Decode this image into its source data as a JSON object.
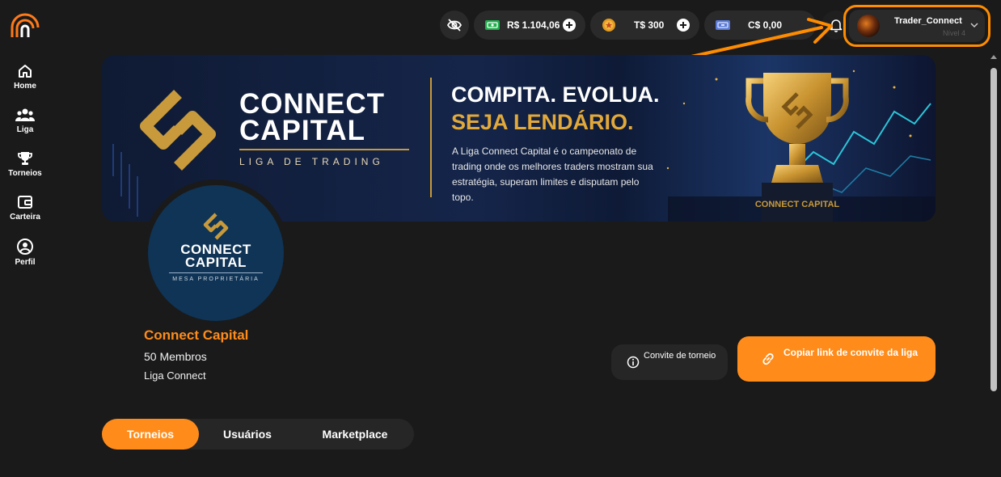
{
  "sidebar": {
    "logo_icon": "app-logo-arc-icon",
    "items": [
      {
        "label": "Home",
        "icon": "home-icon"
      },
      {
        "label": "Liga",
        "icon": "users-icon"
      },
      {
        "label": "Torneios",
        "icon": "trophy-icon"
      },
      {
        "label": "Carteira",
        "icon": "wallet-icon"
      },
      {
        "label": "Perfil",
        "icon": "user-circle-icon"
      }
    ]
  },
  "topbar": {
    "hide_balance_icon": "eye-off-icon",
    "wallets": [
      {
        "amount": "R$ 1.104,06",
        "icon": "cash-icon",
        "has_add": true
      },
      {
        "amount": "T$ 300",
        "icon": "coin-icon",
        "has_add": true
      },
      {
        "amount": "C$ 0,00",
        "icon": "money-card-icon",
        "has_add": false
      }
    ],
    "notifications_icon": "bell-icon",
    "user": {
      "name": "Trader_Connect",
      "level": "Nível 4"
    }
  },
  "banner": {
    "brand_title_line1": "CONNECT",
    "brand_title_line2": "CAPITAL",
    "brand_subtitle": "LIGA DE TRADING",
    "headline1": "COMPITA. EVOLUA.",
    "headline2": "SEJA LENDÁRIO.",
    "description": "A Liga Connect Capital é o campeonato de trading onde os melhores traders mostram sua estratégia, superam limites e disputam pelo topo.",
    "trophy_text": "CONNECT CAPITAL"
  },
  "league": {
    "avatar_title_line1": "CONNECT",
    "avatar_title_line2": "CAPITAL",
    "avatar_subtitle": "MESA PROPRIETÁRIA",
    "name": "Connect Capital",
    "members": "50 Membros",
    "type": "Liga Connect"
  },
  "actions": {
    "invite_label": "Convite de torneio",
    "copy_label": "Copiar link de convite da liga"
  },
  "tabs": [
    {
      "label": "Torneios",
      "active": true
    },
    {
      "label": "Usuários",
      "active": false
    },
    {
      "label": "Marketplace",
      "active": false
    }
  ],
  "colors": {
    "accent": "#ff8c1a",
    "background": "#1a1a1a",
    "surface": "#2a2a2a",
    "gold": "#c89a3b",
    "banner_blue": "#15254a"
  }
}
